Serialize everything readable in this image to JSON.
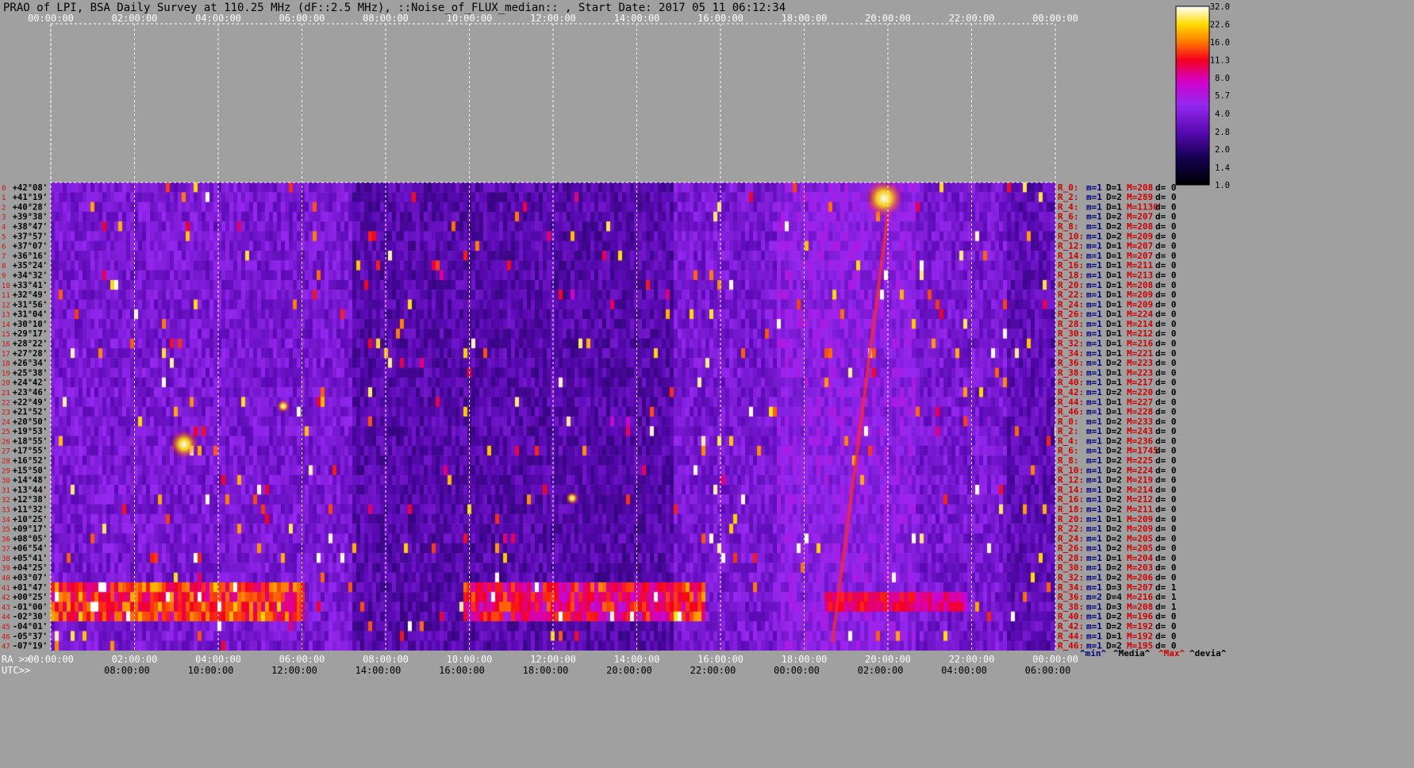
{
  "title": "PRAO of LPI, BSA Daily Survey at 110.25 MHz (dF::2.5 MHz), ::Noise_of_FLUX_median:: , Start Date: 2017 05 11 06:12:34",
  "colors": {
    "background": "#a0a0a0",
    "grid": "#ffffff",
    "tick_text": "#ffffff",
    "index_text": "#d01010",
    "stat_label": "#d00000",
    "stat_value": "#000080",
    "stat_max": "#d00000"
  },
  "chart_data": {
    "type": "heatmap",
    "title": "PRAO of LPI, BSA Daily Survey at 110.25 MHz (dF::2.5 MHz), ::Noise_of_FLUX_median:: , Start Date: 2017 05 11 06:12:34",
    "x_axis_top": [
      "00:00:00",
      "02:00:00",
      "04:00:00",
      "06:00:00",
      "08:00:00",
      "10:00:00",
      "12:00:00",
      "14:00:00",
      "16:00:00",
      "18:00:00",
      "20:00:00",
      "22:00:00",
      "00:00:00"
    ],
    "x_axis_ra": [
      "00:00:00",
      "02:00:00",
      "04:00:00",
      "06:00:00",
      "08:00:00",
      "10:00:00",
      "12:00:00",
      "14:00:00",
      "16:00:00",
      "18:00:00",
      "20:00:00",
      "22:00:00",
      "00:00:00"
    ],
    "x_axis_utc": [
      "08:00:00",
      "10:00:00",
      "12:00:00",
      "14:00:00",
      "16:00:00",
      "18:00:00",
      "20:00:00",
      "22:00:00",
      "00:00:00",
      "02:00:00",
      "04:00:00",
      "06:00:00"
    ],
    "ra_prefix": "RA >>",
    "utc_prefix": "UTC>>",
    "y_declinations": [
      "+42°08'",
      "+41°19'",
      "+40°28'",
      "+39°38'",
      "+38°47'",
      "+37°57'",
      "+37°07'",
      "+36°16'",
      "+35°24'",
      "+34°32'",
      "+33°41'",
      "+32°49'",
      "+31°56'",
      "+31°04'",
      "+30°10'",
      "+29°17'",
      "+28°22'",
      "+27°28'",
      "+26°34'",
      "+25°38'",
      "+24°42'",
      "+23°46'",
      "+22°49'",
      "+21°52'",
      "+20°50'",
      "+19°53'",
      "+18°55'",
      "+17°55'",
      "+16°52'",
      "+15°50'",
      "+14°48'",
      "+13°44'",
      "+12°38'",
      "+11°32'",
      "+10°25'",
      "+09°17'",
      "+08°05'",
      "+06°54'",
      "+05°41'",
      "+04°25'",
      "+03°07'",
      "+01°47'",
      "+00°25'",
      "-01°00'",
      "-02°30'",
      "-04°01'",
      "-05°37'",
      "-07°19'"
    ],
    "colorbar": {
      "ticks": [
        "32.0",
        "22.6",
        "16.0",
        "11.3",
        "8.0",
        "5.7",
        "4.0",
        "2.8",
        "2.0",
        "1.4",
        "1.0"
      ],
      "scale": "log",
      "range": [
        1.0,
        32.0
      ]
    },
    "row_stats": [
      {
        "label": "R_0:",
        "min": "m=1",
        "d": "D=1",
        "max": "M=208",
        "dev": "d= 0"
      },
      {
        "label": "R_2:",
        "min": "m=1",
        "d": "D=2",
        "max": "M=289",
        "dev": "d= 0"
      },
      {
        "label": "R_4:",
        "min": "m=1",
        "d": "D=1",
        "max": "M=1130",
        "dev": "d= 0"
      },
      {
        "label": "R_6:",
        "min": "m=1",
        "d": "D=2",
        "max": "M=207",
        "dev": "d= 0"
      },
      {
        "label": "R_8:",
        "min": "m=1",
        "d": "D=2",
        "max": "M=208",
        "dev": "d= 0"
      },
      {
        "label": "R_10:",
        "min": "m=1",
        "d": "D=2",
        "max": "M=209",
        "dev": "d= 0"
      },
      {
        "label": "R_12:",
        "min": "m=1",
        "d": "D=1",
        "max": "M=207",
        "dev": "d= 0"
      },
      {
        "label": "R_14:",
        "min": "m=1",
        "d": "D=1",
        "max": "M=207",
        "dev": "d= 0"
      },
      {
        "label": "R_16:",
        "min": "m=1",
        "d": "D=1",
        "max": "M=211",
        "dev": "d= 0"
      },
      {
        "label": "R_18:",
        "min": "m=1",
        "d": "D=1",
        "max": "M=213",
        "dev": "d= 0"
      },
      {
        "label": "R_20:",
        "min": "m=1",
        "d": "D=1",
        "max": "M=208",
        "dev": "d= 0"
      },
      {
        "label": "R_22:",
        "min": "m=1",
        "d": "D=1",
        "max": "M=209",
        "dev": "d= 0"
      },
      {
        "label": "R_24:",
        "min": "m=1",
        "d": "D=1",
        "max": "M=209",
        "dev": "d= 0"
      },
      {
        "label": "R_26:",
        "min": "m=1",
        "d": "D=1",
        "max": "M=224",
        "dev": "d= 0"
      },
      {
        "label": "R_28:",
        "min": "m=1",
        "d": "D=1",
        "max": "M=214",
        "dev": "d= 0"
      },
      {
        "label": "R_30:",
        "min": "m=1",
        "d": "D=1",
        "max": "M=212",
        "dev": "d= 0"
      },
      {
        "label": "R_32:",
        "min": "m=1",
        "d": "D=1",
        "max": "M=216",
        "dev": "d= 0"
      },
      {
        "label": "R_34:",
        "min": "m=1",
        "d": "D=1",
        "max": "M=221",
        "dev": "d= 0"
      },
      {
        "label": "R_36:",
        "min": "m=1",
        "d": "D=2",
        "max": "M=223",
        "dev": "d= 0"
      },
      {
        "label": "R_38:",
        "min": "m=1",
        "d": "D=1",
        "max": "M=223",
        "dev": "d= 0"
      },
      {
        "label": "R_40:",
        "min": "m=1",
        "d": "D=1",
        "max": "M=217",
        "dev": "d= 0"
      },
      {
        "label": "R_42:",
        "min": "m=1",
        "d": "D=2",
        "max": "M=220",
        "dev": "d= 0"
      },
      {
        "label": "R_44:",
        "min": "m=1",
        "d": "D=1",
        "max": "M=227",
        "dev": "d= 0"
      },
      {
        "label": "R_46:",
        "min": "m=1",
        "d": "D=1",
        "max": "M=228",
        "dev": "d= 0"
      },
      {
        "label": "R_0:",
        "min": "m=1",
        "d": "D=2",
        "max": "M=233",
        "dev": "d= 0"
      },
      {
        "label": "R_2:",
        "min": "m=1",
        "d": "D=2",
        "max": "M=243",
        "dev": "d= 0"
      },
      {
        "label": "R_4:",
        "min": "m=1",
        "d": "D=2",
        "max": "M=236",
        "dev": "d= 0"
      },
      {
        "label": "R_6:",
        "min": "m=1",
        "d": "D=2",
        "max": "M=1745",
        "dev": "d= 0"
      },
      {
        "label": "R_8:",
        "min": "m=1",
        "d": "D=2",
        "max": "M=225",
        "dev": "d= 0"
      },
      {
        "label": "R_10:",
        "min": "m=1",
        "d": "D=2",
        "max": "M=224",
        "dev": "d= 0"
      },
      {
        "label": "R_12:",
        "min": "m=1",
        "d": "D=2",
        "max": "M=219",
        "dev": "d= 0"
      },
      {
        "label": "R_14:",
        "min": "m=1",
        "d": "D=2",
        "max": "M=214",
        "dev": "d= 0"
      },
      {
        "label": "R_16:",
        "min": "m=1",
        "d": "D=2",
        "max": "M=212",
        "dev": "d= 0"
      },
      {
        "label": "R_18:",
        "min": "m=1",
        "d": "D=2",
        "max": "M=211",
        "dev": "d= 0"
      },
      {
        "label": "R_20:",
        "min": "m=1",
        "d": "D=1",
        "max": "M=209",
        "dev": "d= 0"
      },
      {
        "label": "R_22:",
        "min": "m=1",
        "d": "D=2",
        "max": "M=209",
        "dev": "d= 0"
      },
      {
        "label": "R_24:",
        "min": "m=1",
        "d": "D=2",
        "max": "M=205",
        "dev": "d= 0"
      },
      {
        "label": "R_26:",
        "min": "m=1",
        "d": "D=2",
        "max": "M=205",
        "dev": "d= 0"
      },
      {
        "label": "R_28:",
        "min": "m=1",
        "d": "D=1",
        "max": "M=204",
        "dev": "d= 0"
      },
      {
        "label": "R_30:",
        "min": "m=1",
        "d": "D=2",
        "max": "M=203",
        "dev": "d= 0"
      },
      {
        "label": "R_32:",
        "min": "m=1",
        "d": "D=2",
        "max": "M=206",
        "dev": "d= 0"
      },
      {
        "label": "R_34:",
        "min": "m=1",
        "d": "D=3",
        "max": "M=207",
        "dev": "d= 1"
      },
      {
        "label": "R_36:",
        "min": "m=2",
        "d": "D=4",
        "max": "M=216",
        "dev": "d= 1"
      },
      {
        "label": "R_38:",
        "min": "m=1",
        "d": "D=3",
        "max": "M=208",
        "dev": "d= 1"
      },
      {
        "label": "R_40:",
        "min": "m=1",
        "d": "D=2",
        "max": "M=196",
        "dev": "d= 0"
      },
      {
        "label": "R_42:",
        "min": "m=1",
        "d": "D=2",
        "max": "M=192",
        "dev": "d= 0"
      },
      {
        "label": "R_44:",
        "min": "m=1",
        "d": "D=1",
        "max": "M=192",
        "dev": "d= 0"
      },
      {
        "label": "R_46:",
        "min": "m=1",
        "d": "D=2",
        "max": "M=195",
        "dev": "d= 0"
      }
    ],
    "stats_legend": [
      "^min^",
      "^Media^",
      "^Max^",
      "^devia^"
    ]
  }
}
